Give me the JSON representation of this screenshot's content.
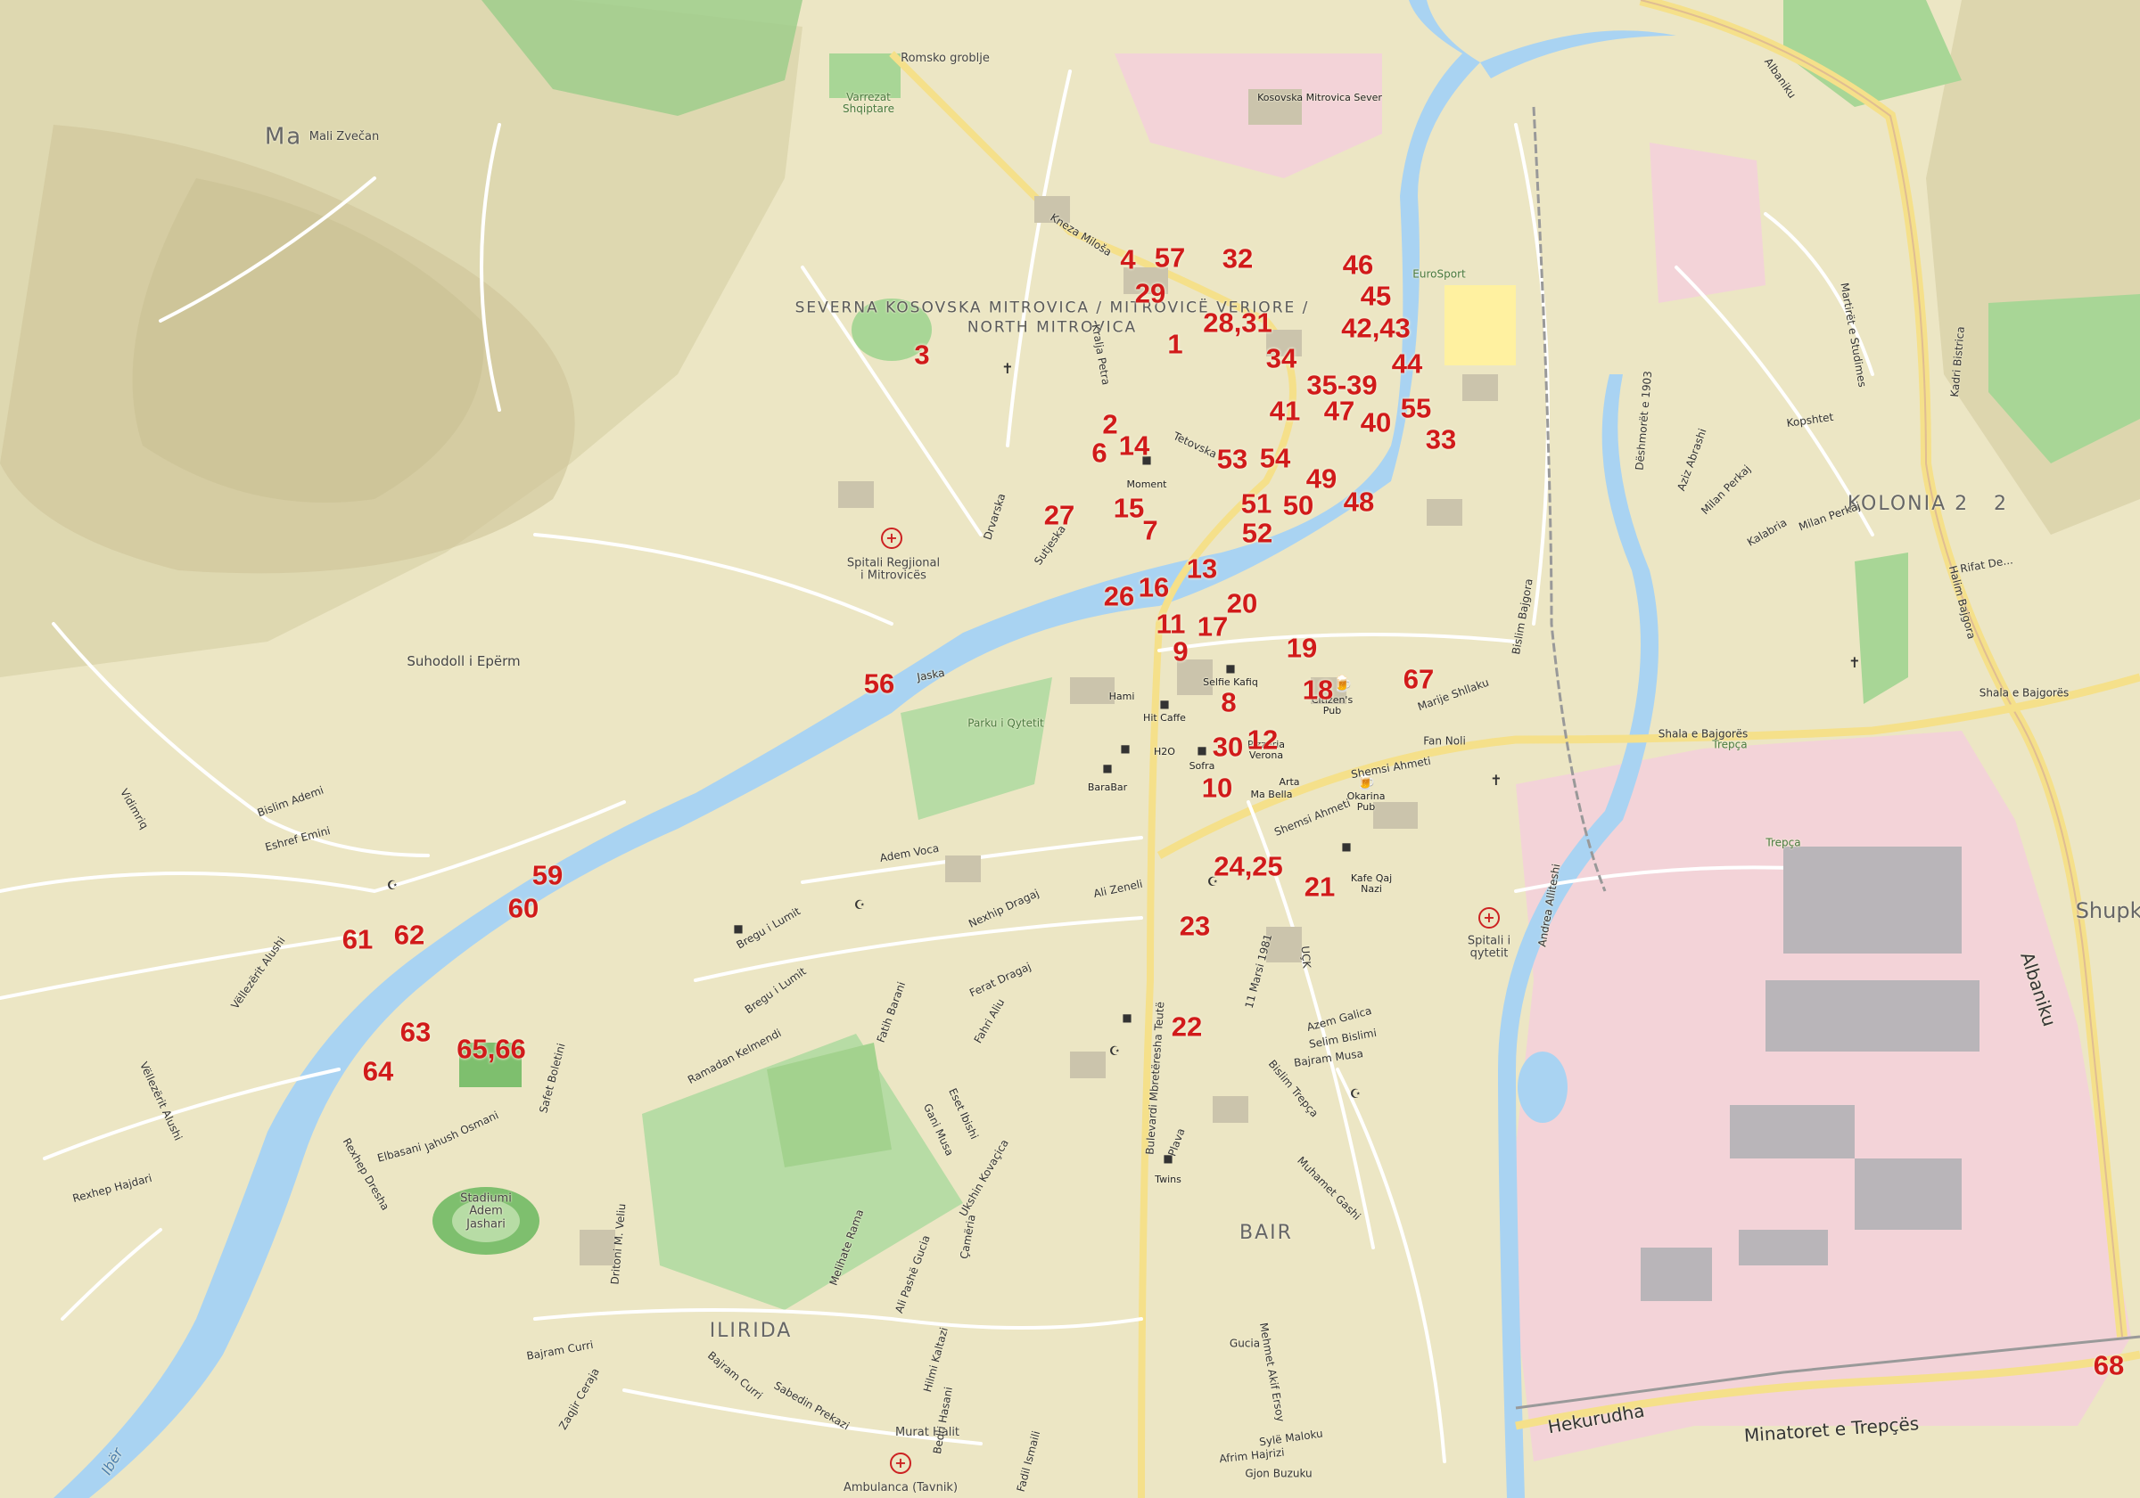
{
  "map": {
    "markers": [
      {
        "id": "m1",
        "text": "1"
      },
      {
        "id": "m2",
        "text": "2"
      },
      {
        "id": "m3",
        "text": "3"
      },
      {
        "id": "m4",
        "text": "4"
      },
      {
        "id": "m6",
        "text": "6"
      },
      {
        "id": "m7",
        "text": "7"
      },
      {
        "id": "m8",
        "text": "8"
      },
      {
        "id": "m9",
        "text": "9"
      },
      {
        "id": "m10",
        "text": "10"
      },
      {
        "id": "m11",
        "text": "11"
      },
      {
        "id": "m12",
        "text": "12"
      },
      {
        "id": "m13",
        "text": "13"
      },
      {
        "id": "m14",
        "text": "14"
      },
      {
        "id": "m15",
        "text": "15"
      },
      {
        "id": "m16",
        "text": "16"
      },
      {
        "id": "m17",
        "text": "17"
      },
      {
        "id": "m18",
        "text": "18"
      },
      {
        "id": "m19",
        "text": "19"
      },
      {
        "id": "m20",
        "text": "20"
      },
      {
        "id": "m21",
        "text": "21"
      },
      {
        "id": "m22",
        "text": "22"
      },
      {
        "id": "m23",
        "text": "23"
      },
      {
        "id": "m24",
        "text": "24,25"
      },
      {
        "id": "m26",
        "text": "26"
      },
      {
        "id": "m27",
        "text": "27"
      },
      {
        "id": "m28",
        "text": "28,31"
      },
      {
        "id": "m29",
        "text": "29"
      },
      {
        "id": "m30",
        "text": "30"
      },
      {
        "id": "m32",
        "text": "32"
      },
      {
        "id": "m33",
        "text": "33"
      },
      {
        "id": "m34",
        "text": "34"
      },
      {
        "id": "m35",
        "text": "35-39"
      },
      {
        "id": "m40",
        "text": "40"
      },
      {
        "id": "m41",
        "text": "41"
      },
      {
        "id": "m42",
        "text": "42,43"
      },
      {
        "id": "m44",
        "text": "44"
      },
      {
        "id": "m45",
        "text": "45"
      },
      {
        "id": "m46",
        "text": "46"
      },
      {
        "id": "m47",
        "text": "47"
      },
      {
        "id": "m48",
        "text": "48"
      },
      {
        "id": "m49",
        "text": "49"
      },
      {
        "id": "m50",
        "text": "50"
      },
      {
        "id": "m51",
        "text": "51"
      },
      {
        "id": "m52",
        "text": "52"
      },
      {
        "id": "m53",
        "text": "53"
      },
      {
        "id": "m54",
        "text": "54"
      },
      {
        "id": "m55",
        "text": "55"
      },
      {
        "id": "m56",
        "text": "56"
      },
      {
        "id": "m57",
        "text": "57"
      },
      {
        "id": "m59",
        "text": "59"
      },
      {
        "id": "m60",
        "text": "60"
      },
      {
        "id": "m61",
        "text": "61"
      },
      {
        "id": "m62",
        "text": "62"
      },
      {
        "id": "m63",
        "text": "63"
      },
      {
        "id": "m64",
        "text": "64"
      },
      {
        "id": "m65",
        "text": "65,66"
      },
      {
        "id": "m67",
        "text": "67"
      },
      {
        "id": "m68",
        "text": "68"
      }
    ],
    "places": {
      "north_mitrovica_1": "SEVERNA KOSOVSKA MITROVICA / MITROVICË VERIORE /",
      "north_mitrovica_2": "NORTH MITROVICA",
      "kosovska_mitrovica_sever": "Kosovska Mitrovica Sever",
      "kolonia": "KOLONIA 2",
      "ilirida": "ILIRIDA",
      "bair": "BAIR",
      "suhodoll": "Suhodoll i Epërm",
      "mali_zvecan": "Mali Zvečan",
      "ma": "Ma",
      "shupko": "Shupko",
      "two": "2",
      "trepca": "Trepça",
      "trepca2": "Trepça",
      "eurosport": "EuroSport"
    },
    "pois": {
      "hospital_regional": "Spitali Regjional i Mitrovicës",
      "hospital_city": "Spitali i qytetit",
      "ambulanca": "Ambulanca (Tavnik)",
      "murat_halit": "Murat Halit",
      "stadium": "Stadiumi Adem Jashari",
      "park": "Parku i Qytetit",
      "varrezat": "Varrezat Shqiptare",
      "romsko": "Romsko groblje",
      "selfie": "Selfie Kafiq",
      "hit_caffe": "Hit Caffe",
      "h2o": "H2O",
      "sofra": "Sofra",
      "barabar": "BaraBar",
      "pizzeria": "Pizzeria Verona",
      "ma_bella": "Ma Bella",
      "arta": "Arta",
      "citizens": "Citizen's Pub",
      "okarina": "Okarina Pub",
      "kafe_qaj": "Kafe Qaj Nazi",
      "twins": "Twins",
      "moment": "Moment",
      "hamr": "Hami"
    },
    "roads": {
      "albaniku_top": "Albaniku",
      "albaniku_right": "Albaniku",
      "hekurudha": "Hekurudha",
      "minatoret": "Minatoret e Trepçës",
      "shala_bajgores": "Shala e Bajgorës",
      "shala_e_bajgores2": "Shala e Bajgorës",
      "kneza_milosa": "Kneza Miloša",
      "tetovska": "Tetovska",
      "sutjeska": "Sutjeska",
      "drvarska": "Drvarska",
      "kralja_petra": "Kralja Petra",
      "bulevardi": "Bulevardi Mbretëresha Teutë",
      "shemsi_ahmeti": "Shemsi Ahmeti",
      "shemsi_ahmeti2": "Shemsi Ahmeti",
      "adem_voca": "Adem Voca",
      "ali_zeneli": "Ali Zeneli",
      "nexhip_dragaj": "Nexhip Dragaj",
      "ferat_dragaj": "Ferat Dragaj",
      "ramadan_kelmendi": "Ramadan Kelmendi",
      "ukshin_kovacica": "Ukshin Kovaçica",
      "bislim_ademi": "Bislim Ademi",
      "eshref_emini": "Eshref Emini",
      "vidimriq": "Vidimriq",
      "vellezerit_alushi": "Vëllezërit Alushi",
      "vellezerit_alushi2": "Vëllezërit Alushi",
      "rexhep_hajdari": "Rexhep Hajdari",
      "rexhep_dresha": "Rexhep Dresha",
      "elbasani": "Elbasani",
      "janush_osmani": "Jahush Osmani",
      "safet_boletini": "Safet Boletini",
      "ibri": "Ibër",
      "bislim_bajgora": "Bislim Bajgora",
      "dieshmoret": "Dëshmorët e 1903",
      "aziz_abrashi": "Aziz Abrashi",
      "kopshtet": "Kopshtet",
      "milan_perkaj": "Milan Perkaj",
      "kalabria": "Kalabria",
      "martiret": "Martirët e Studimes",
      "kadri_bistrica": "Kadri Bistrica",
      "rifat_de": "Rifat De...",
      "halim_bajgora": "Halim Bajgora",
      "fan_noli": "Fan Noli",
      "marije_shllaku": "Marije Shllaku",
      "andrea_aliteshi": "Andrea Alliteshi",
      "11_marsi": "11 Marsi 1981",
      "ucк": "UÇK",
      "azem_galica": "Azem Galica",
      "selim_bislimi": "Selim Bislimi",
      "bajram_musa": "Bajram Musa",
      "bislim_trepca": "Bislim Trepça",
      "muhamet_gashi": "Muhamet Gashi",
      "gucia": "Gucia",
      "mehmet_akif": "Mehmet Akif Ersoy",
      "syle_maloku": "Sylë Maloku",
      "afrim_hajrizi": "Afrim Hajrizi",
      "gjon_buzuku": "Gjon Buzuku",
      "fadil_ismaili": "Fadil Ismaili",
      "sabedin": "Sabedin Prekazi",
      "bajram_curri": "Bajram Curri",
      "bajram_curri2": "Bajram Curri",
      "meliha": "Melihate Rama",
      "ali_pashe": "Ali Pashë Gucia",
      "dritoni": "Dritoni M. Veliu",
      "cameria": "Çamëria",
      "fadil_hoxha": "Fahri Aliu",
      "eset_ibishi": "Eset Ibishi",
      "gani_musa": "Gani Musa",
      "fatih_barani": "Fatih Barani",
      "breg_lumit": "Bregu i Lumit",
      "breg_lumit2": "Bregu i Lumit",
      "himzi": "Hilmi Kaltazi",
      "bedri_hasani": "Bedri Hasani",
      "zogaj": "Zaqjir Ceraja",
      "mitrovica_jaska": "Jaska",
      "ptan": "Plava"
    },
    "colors": {
      "land": "#ece6c4",
      "hills": "#d4cba1",
      "forest": "#9fce8c",
      "river": "#a9d3f2",
      "industrial": "#f3d3d8",
      "highway": "#f5e08a",
      "marker": "#d11a1a"
    },
    "icons": {
      "hospital": "hospital-icon",
      "cafe": "cafe-icon",
      "church": "church-icon",
      "mosque": "mosque-icon",
      "bar": "bar-icon"
    }
  }
}
